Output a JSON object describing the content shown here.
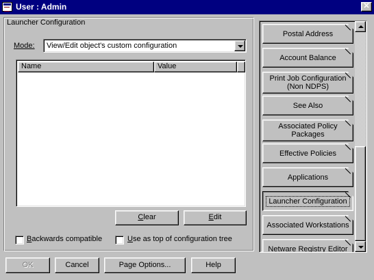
{
  "window": {
    "title": "User : Admin",
    "icon": "user-object-icon",
    "close_icon": "close-icon",
    "close_glyph": "✕"
  },
  "launcher": {
    "panel_title": "Launcher Configuration",
    "mode_label": "Mode:",
    "mode_value": "View/Edit object's custom configuration",
    "columns": [
      "Name",
      "Value"
    ],
    "rows": [],
    "clear_label_underlined": "C",
    "clear_label_rest": "lear",
    "edit_label_underlined": "E",
    "edit_label_rest": "dit",
    "checkboxes": [
      {
        "label_underlined": "B",
        "label_rest": "ackwards compatible",
        "checked": false
      },
      {
        "label_underlined": "U",
        "label_rest": "se as top of configuration tree",
        "checked": false
      }
    ]
  },
  "footer": {
    "ok_label": "OK",
    "cancel_label": "Cancel",
    "page_options_label": "Page Options...",
    "help_label": "Help"
  },
  "tabs": {
    "items": [
      {
        "label": "Postal Address",
        "selected": false
      },
      {
        "label": "Account Balance",
        "selected": false
      },
      {
        "label": "Print Job Configuration (Non NDPS)",
        "selected": false
      },
      {
        "label": "See Also",
        "selected": false
      },
      {
        "label": "Associated Policy Packages",
        "selected": false
      },
      {
        "label": "Effective Policies",
        "selected": false
      },
      {
        "label": "Applications",
        "selected": false
      },
      {
        "label": "Launcher Configuration",
        "selected": true
      },
      {
        "label": "Associated Workstations",
        "selected": false
      },
      {
        "label": "Netware Registry Editor",
        "selected": false
      }
    ],
    "scroll_position": 0.6
  }
}
